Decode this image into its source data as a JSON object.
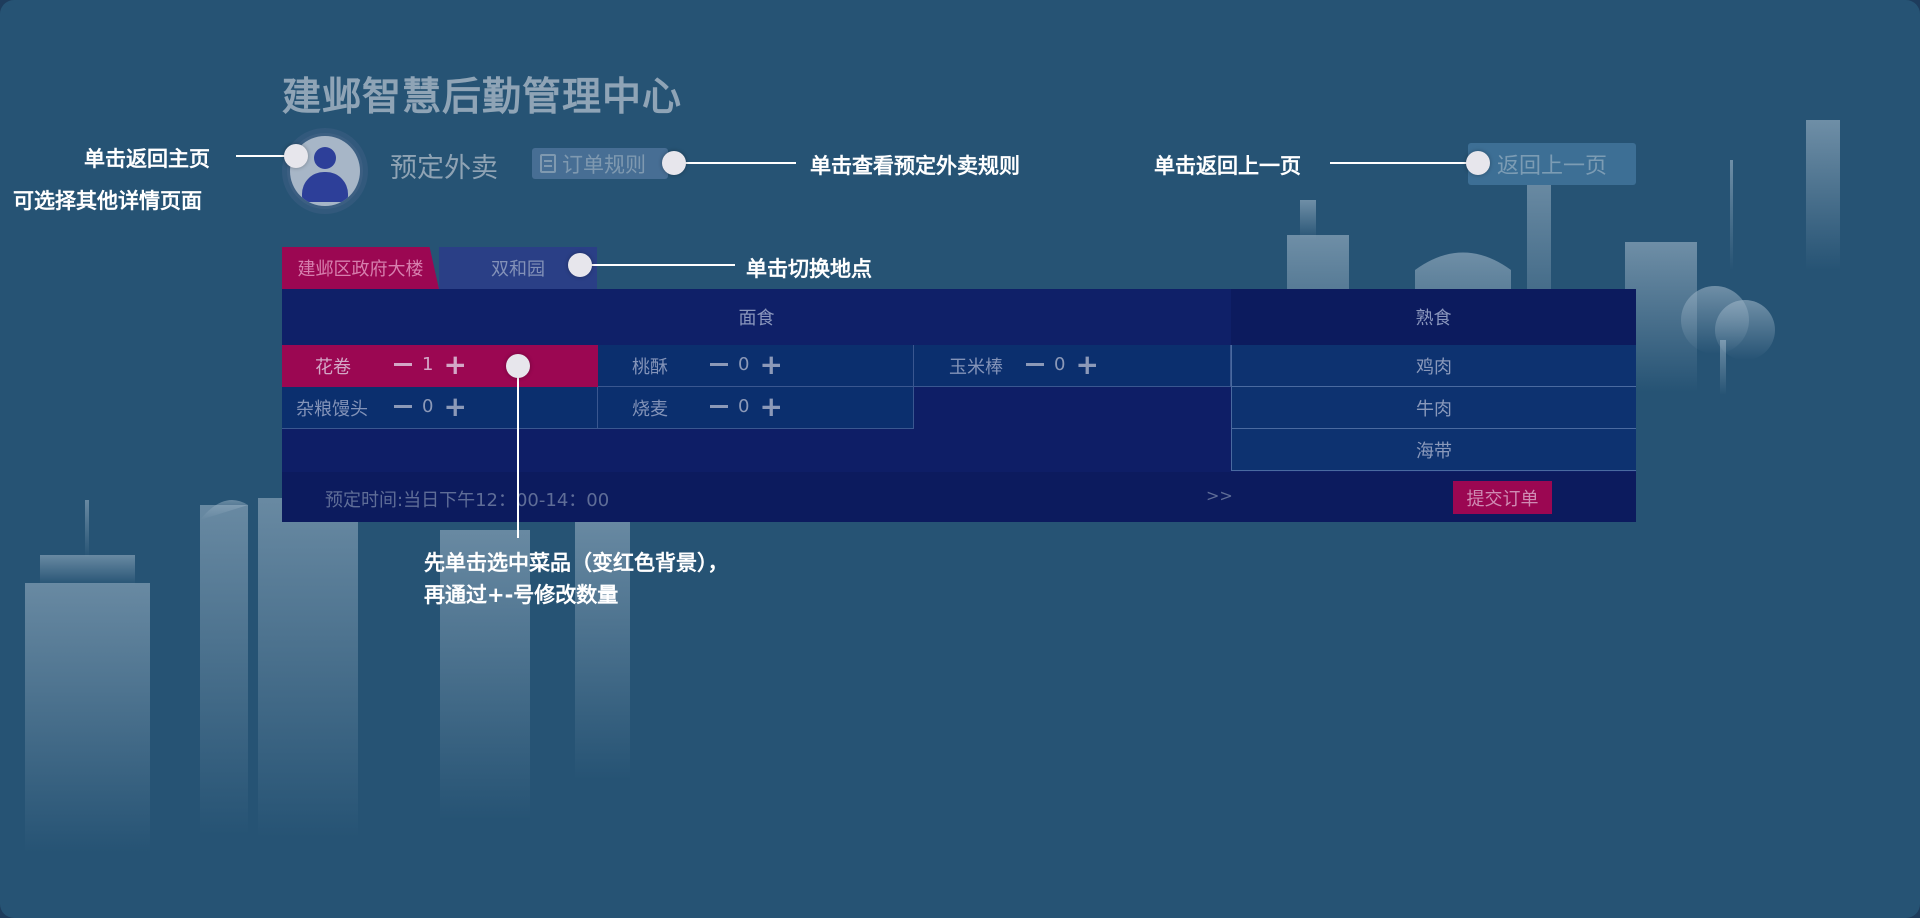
{
  "app": {
    "title": "建邺智慧后勤管理中心",
    "section_title": "预定外卖",
    "rules_button_label": "订单规则",
    "back_button_label": "返回上一页"
  },
  "locations": [
    {
      "label": "建邺区政府大楼",
      "selected": true
    },
    {
      "label": "双和园",
      "selected": false
    }
  ],
  "categories": {
    "left_header": "面食",
    "right_header": "熟食"
  },
  "pasta_items": [
    {
      "name": "花卷",
      "qty": "1",
      "selected": true
    },
    {
      "name": "桃酥",
      "qty": "0",
      "selected": false
    },
    {
      "name": "玉米棒",
      "qty": "0",
      "selected": false
    },
    {
      "name": "杂粮馒头",
      "qty": "0",
      "selected": false
    },
    {
      "name": "烧麦",
      "qty": "0",
      "selected": false
    }
  ],
  "cooked_items": [
    {
      "name": "鸡肉"
    },
    {
      "name": "牛肉"
    },
    {
      "name": "海带"
    }
  ],
  "footer": {
    "time_text": "预定时间:当日下午12：00-14：00",
    "more_text": ">>",
    "submit_label": "提交订单"
  },
  "annotations": {
    "home_line1": "单击返回主页",
    "home_line2": "可选择其他详情页面",
    "rules": "单击查看预定外卖规则",
    "back": "单击返回上一页",
    "location": "单击切换地点",
    "select_line1": "先单击选中菜品（变红色背景），",
    "select_line2": "再通过+-号修改数量"
  },
  "colors": {
    "background": "#265374",
    "accent_red": "#9b0752",
    "panel_navy": "#0e1e66"
  }
}
